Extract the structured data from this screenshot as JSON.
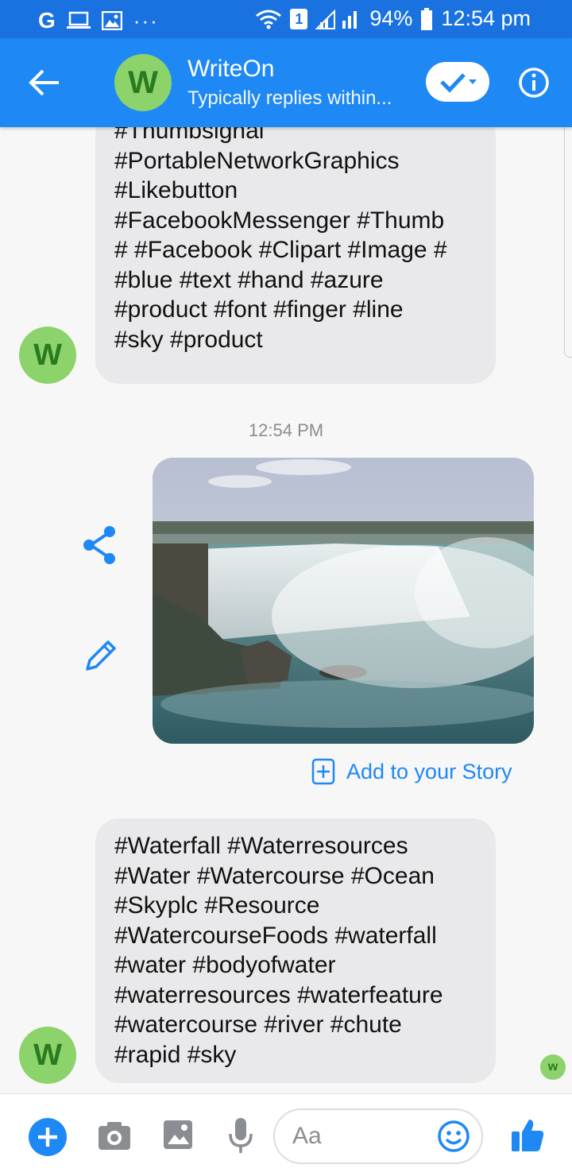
{
  "status_bar": {
    "left_icons": [
      "google-g-icon",
      "laptop-icon",
      "image-icon"
    ],
    "g_glyph": "G",
    "more": "···",
    "sim_badge": "1",
    "battery": "94%",
    "time": "12:54 pm"
  },
  "header": {
    "avatar_letter": "W",
    "title": "WriteOn",
    "subtitle": "Typically replies within..."
  },
  "messages": [
    {
      "sender_avatar": "W",
      "text": "#Thumbsignal\n#PortableNetworkGraphics\n#Likebutton\n#FacebookMessenger #Thumb\n# #Facebook #Clipart #Image #\n#blue #text #hand #azure\n#product #font #finger #line\n#sky #product"
    },
    {
      "sender_avatar": "W",
      "text": "#Waterfall #Waterresources\n#Water #Watercourse #Ocean\n#Skyplc #Resource\n#WatercourseFoods #waterfall\n#water #bodyofwater\n#waterresources #waterfeature\n#watercourse #river #chute\n#rapid #sky"
    }
  ],
  "timestamp": "12:54 PM",
  "photo_caption_icon": "waterfall-photo",
  "add_to_story": "Add to your Story",
  "seen_avatar": "w",
  "composer": {
    "placeholder": "Aa"
  },
  "colors": {
    "accent": "#1e88f5",
    "status_bar": "#1a72e0",
    "bubble": "#e9e9eb",
    "avatar": "#8bd36a"
  }
}
